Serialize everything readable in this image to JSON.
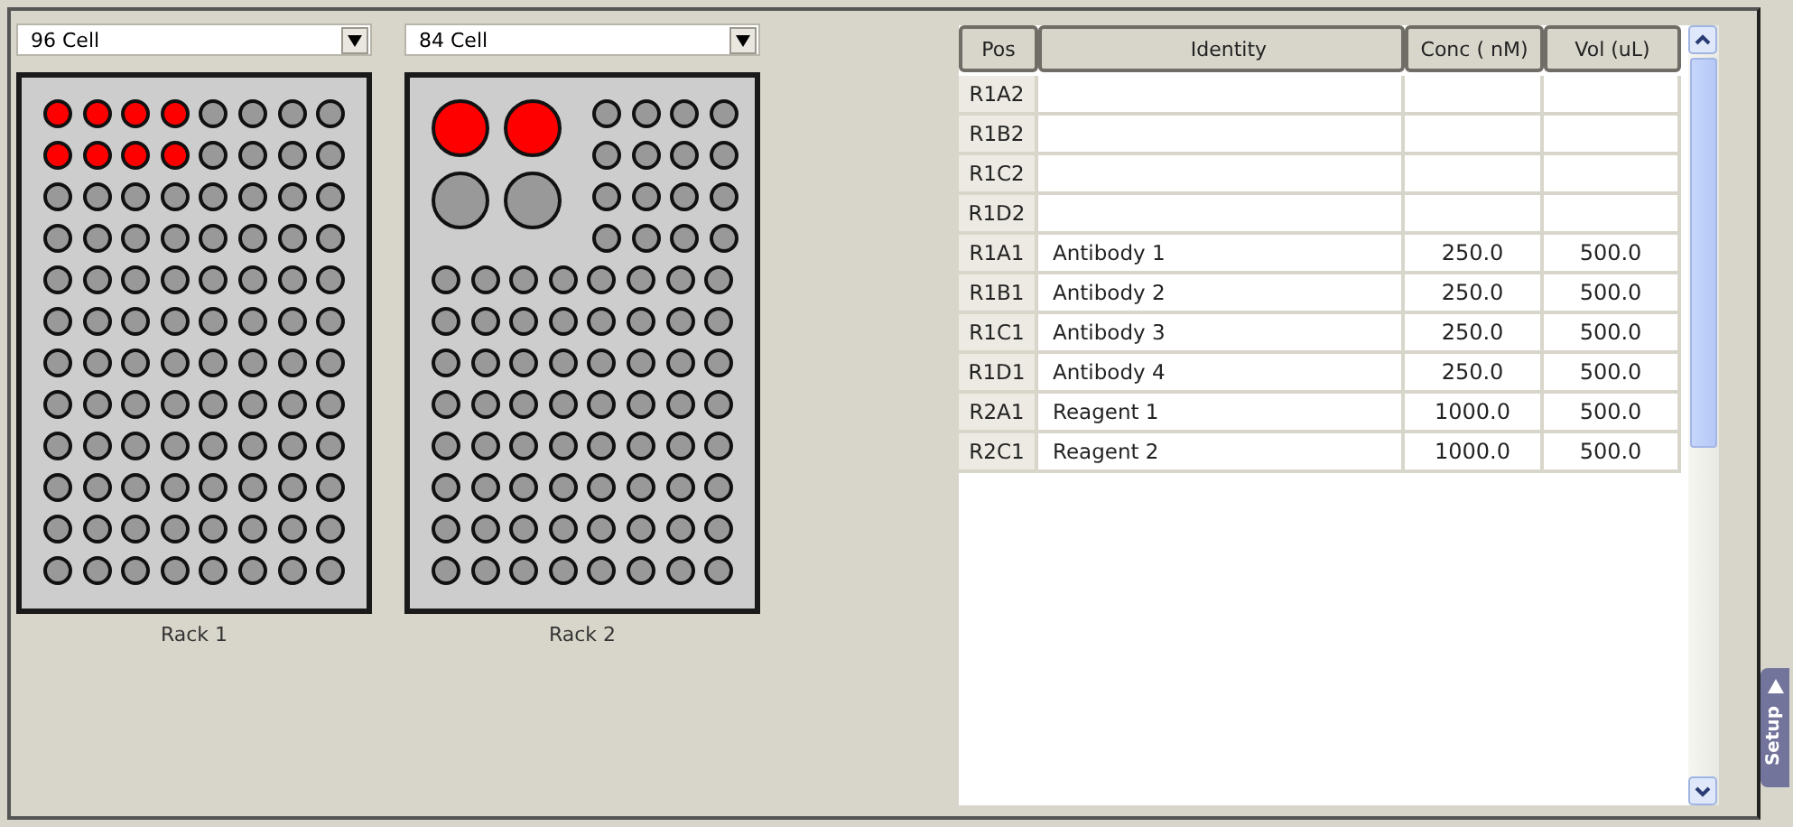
{
  "racks": [
    {
      "format": "96 Cell",
      "label": "Rack 1",
      "sections": [
        {
          "blocks": [
            {
              "kind": "small",
              "rows": [
                [
                  {
                    "filled": true
                  },
                  {
                    "filled": true
                  },
                  {
                    "filled": true
                  },
                  {
                    "filled": true
                  },
                  {
                    "filled": false
                  },
                  {
                    "filled": false
                  },
                  {
                    "filled": false
                  },
                  {
                    "filled": false
                  }
                ],
                [
                  {
                    "filled": true
                  },
                  {
                    "filled": true
                  },
                  {
                    "filled": true
                  },
                  {
                    "filled": true
                  },
                  {
                    "filled": false
                  },
                  {
                    "filled": false
                  },
                  {
                    "filled": false
                  },
                  {
                    "filled": false
                  }
                ],
                [
                  {
                    "filled": false
                  },
                  {
                    "filled": false
                  },
                  {
                    "filled": false
                  },
                  {
                    "filled": false
                  },
                  {
                    "filled": false
                  },
                  {
                    "filled": false
                  },
                  {
                    "filled": false
                  },
                  {
                    "filled": false
                  }
                ],
                [
                  {
                    "filled": false
                  },
                  {
                    "filled": false
                  },
                  {
                    "filled": false
                  },
                  {
                    "filled": false
                  },
                  {
                    "filled": false
                  },
                  {
                    "filled": false
                  },
                  {
                    "filled": false
                  },
                  {
                    "filled": false
                  }
                ],
                [
                  {
                    "filled": false
                  },
                  {
                    "filled": false
                  },
                  {
                    "filled": false
                  },
                  {
                    "filled": false
                  },
                  {
                    "filled": false
                  },
                  {
                    "filled": false
                  },
                  {
                    "filled": false
                  },
                  {
                    "filled": false
                  }
                ],
                [
                  {
                    "filled": false
                  },
                  {
                    "filled": false
                  },
                  {
                    "filled": false
                  },
                  {
                    "filled": false
                  },
                  {
                    "filled": false
                  },
                  {
                    "filled": false
                  },
                  {
                    "filled": false
                  },
                  {
                    "filled": false
                  }
                ],
                [
                  {
                    "filled": false
                  },
                  {
                    "filled": false
                  },
                  {
                    "filled": false
                  },
                  {
                    "filled": false
                  },
                  {
                    "filled": false
                  },
                  {
                    "filled": false
                  },
                  {
                    "filled": false
                  },
                  {
                    "filled": false
                  }
                ],
                [
                  {
                    "filled": false
                  },
                  {
                    "filled": false
                  },
                  {
                    "filled": false
                  },
                  {
                    "filled": false
                  },
                  {
                    "filled": false
                  },
                  {
                    "filled": false
                  },
                  {
                    "filled": false
                  },
                  {
                    "filled": false
                  }
                ],
                [
                  {
                    "filled": false
                  },
                  {
                    "filled": false
                  },
                  {
                    "filled": false
                  },
                  {
                    "filled": false
                  },
                  {
                    "filled": false
                  },
                  {
                    "filled": false
                  },
                  {
                    "filled": false
                  },
                  {
                    "filled": false
                  }
                ],
                [
                  {
                    "filled": false
                  },
                  {
                    "filled": false
                  },
                  {
                    "filled": false
                  },
                  {
                    "filled": false
                  },
                  {
                    "filled": false
                  },
                  {
                    "filled": false
                  },
                  {
                    "filled": false
                  },
                  {
                    "filled": false
                  }
                ],
                [
                  {
                    "filled": false
                  },
                  {
                    "filled": false
                  },
                  {
                    "filled": false
                  },
                  {
                    "filled": false
                  },
                  {
                    "filled": false
                  },
                  {
                    "filled": false
                  },
                  {
                    "filled": false
                  },
                  {
                    "filled": false
                  }
                ],
                [
                  {
                    "filled": false
                  },
                  {
                    "filled": false
                  },
                  {
                    "filled": false
                  },
                  {
                    "filled": false
                  },
                  {
                    "filled": false
                  },
                  {
                    "filled": false
                  },
                  {
                    "filled": false
                  },
                  {
                    "filled": false
                  }
                ]
              ]
            }
          ]
        }
      ]
    },
    {
      "format": "84 Cell",
      "label": "Rack 2",
      "sections": [
        {
          "blocks": [
            {
              "kind": "large",
              "rows": [
                [
                  {
                    "filled": true
                  },
                  {
                    "filled": true
                  }
                ],
                [
                  {
                    "filled": false
                  },
                  {
                    "filled": false
                  }
                ]
              ]
            },
            {
              "kind": "small",
              "rows": [
                [
                  {
                    "filled": false
                  },
                  {
                    "filled": false
                  },
                  {
                    "filled": false
                  },
                  {
                    "filled": false
                  }
                ],
                [
                  {
                    "filled": false
                  },
                  {
                    "filled": false
                  },
                  {
                    "filled": false
                  },
                  {
                    "filled": false
                  }
                ],
                [
                  {
                    "filled": false
                  },
                  {
                    "filled": false
                  },
                  {
                    "filled": false
                  },
                  {
                    "filled": false
                  }
                ],
                [
                  {
                    "filled": false
                  },
                  {
                    "filled": false
                  },
                  {
                    "filled": false
                  },
                  {
                    "filled": false
                  }
                ]
              ]
            }
          ]
        },
        {
          "blocks": [
            {
              "kind": "small",
              "rows": [
                [
                  {
                    "filled": false
                  },
                  {
                    "filled": false
                  },
                  {
                    "filled": false
                  },
                  {
                    "filled": false
                  },
                  {
                    "filled": false
                  },
                  {
                    "filled": false
                  },
                  {
                    "filled": false
                  },
                  {
                    "filled": false
                  }
                ],
                [
                  {
                    "filled": false
                  },
                  {
                    "filled": false
                  },
                  {
                    "filled": false
                  },
                  {
                    "filled": false
                  },
                  {
                    "filled": false
                  },
                  {
                    "filled": false
                  },
                  {
                    "filled": false
                  },
                  {
                    "filled": false
                  }
                ],
                [
                  {
                    "filled": false
                  },
                  {
                    "filled": false
                  },
                  {
                    "filled": false
                  },
                  {
                    "filled": false
                  },
                  {
                    "filled": false
                  },
                  {
                    "filled": false
                  },
                  {
                    "filled": false
                  },
                  {
                    "filled": false
                  }
                ],
                [
                  {
                    "filled": false
                  },
                  {
                    "filled": false
                  },
                  {
                    "filled": false
                  },
                  {
                    "filled": false
                  },
                  {
                    "filled": false
                  },
                  {
                    "filled": false
                  },
                  {
                    "filled": false
                  },
                  {
                    "filled": false
                  }
                ],
                [
                  {
                    "filled": false
                  },
                  {
                    "filled": false
                  },
                  {
                    "filled": false
                  },
                  {
                    "filled": false
                  },
                  {
                    "filled": false
                  },
                  {
                    "filled": false
                  },
                  {
                    "filled": false
                  },
                  {
                    "filled": false
                  }
                ],
                [
                  {
                    "filled": false
                  },
                  {
                    "filled": false
                  },
                  {
                    "filled": false
                  },
                  {
                    "filled": false
                  },
                  {
                    "filled": false
                  },
                  {
                    "filled": false
                  },
                  {
                    "filled": false
                  },
                  {
                    "filled": false
                  }
                ],
                [
                  {
                    "filled": false
                  },
                  {
                    "filled": false
                  },
                  {
                    "filled": false
                  },
                  {
                    "filled": false
                  },
                  {
                    "filled": false
                  },
                  {
                    "filled": false
                  },
                  {
                    "filled": false
                  },
                  {
                    "filled": false
                  }
                ],
                [
                  {
                    "filled": false
                  },
                  {
                    "filled": false
                  },
                  {
                    "filled": false
                  },
                  {
                    "filled": false
                  },
                  {
                    "filled": false
                  },
                  {
                    "filled": false
                  },
                  {
                    "filled": false
                  },
                  {
                    "filled": false
                  }
                ]
              ]
            }
          ]
        }
      ]
    }
  ],
  "table": {
    "columns": [
      "Pos",
      "Identity",
      "Conc ( nM)",
      "Vol (uL)"
    ],
    "rows": [
      {
        "pos": "R1A2"
      },
      {
        "pos": "R1B2"
      },
      {
        "pos": "R1C2"
      },
      {
        "pos": "R1D2"
      },
      {
        "pos": "R1A1",
        "identity": "Antibody 1",
        "conc": "250.0",
        "vol": "500.0"
      },
      {
        "pos": "R1B1",
        "identity": "Antibody 2",
        "conc": "250.0",
        "vol": "500.0"
      },
      {
        "pos": "R1C1",
        "identity": "Antibody 3",
        "conc": "250.0",
        "vol": "500.0"
      },
      {
        "pos": "R1D1",
        "identity": "Antibody 4",
        "conc": "250.0",
        "vol": "500.0"
      },
      {
        "pos": "R2A1",
        "identity": "Reagent 1",
        "conc": "1000.0",
        "vol": "500.0"
      },
      {
        "pos": "R2C1",
        "identity": "Reagent 2",
        "conc": "1000.0",
        "vol": "500.0"
      }
    ]
  },
  "side_tab": {
    "label": "Setup"
  }
}
